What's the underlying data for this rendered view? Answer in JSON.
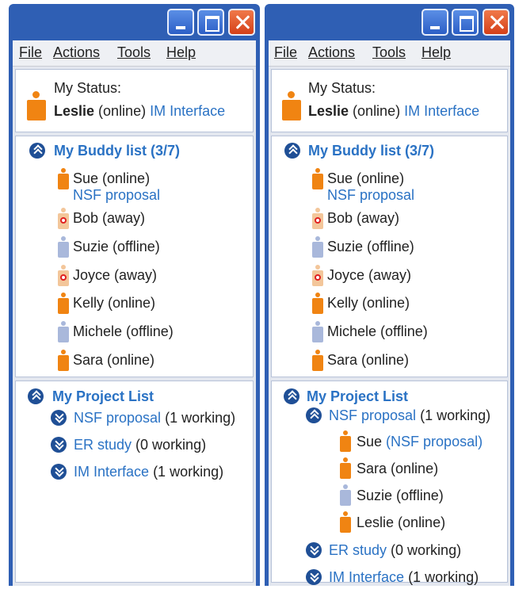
{
  "menu": [
    "File",
    "Actions",
    "Tools",
    "Help"
  ],
  "status": {
    "label": "My Status:",
    "name": "Leslie",
    "state": "(online)",
    "activity": "IM Interface"
  },
  "buddy_list": {
    "title": "My Buddy list (3/7)",
    "buddies": [
      {
        "label": "Sue (online)",
        "status": "online",
        "activity": "NSF proposal"
      },
      {
        "label": "Bob (away)",
        "status": "away"
      },
      {
        "label": "Suzie (offline)",
        "status": "offline"
      },
      {
        "label": "Joyce (away)",
        "status": "away"
      },
      {
        "label": "Kelly (online)",
        "status": "online"
      },
      {
        "label": "Michele (offline)",
        "status": "offline"
      },
      {
        "label": "Sara (online)",
        "status": "online"
      }
    ]
  },
  "project_list": {
    "title": "My Project List",
    "projects": [
      {
        "name": "NSF proposal",
        "count": "(1 working)"
      },
      {
        "name": "ER study",
        "count": "(0 working)"
      },
      {
        "name": "IM Interface",
        "count": "(1 working)"
      }
    ],
    "nsf_members": [
      {
        "name": "Sue",
        "detail": "(NSF proposal)",
        "status": "online"
      },
      {
        "name": "Sara",
        "detail": "(online)",
        "status": "online"
      },
      {
        "name": "Suzie",
        "detail": "(offline)",
        "status": "offline"
      },
      {
        "name": "Leslie",
        "detail": "(online)",
        "status": "online"
      }
    ]
  },
  "colors": {
    "titlebar": "#2f5fb4",
    "link": "#2a72c4",
    "online": "#f08412",
    "offline": "#a9b8db",
    "away": "#f3c69a"
  }
}
